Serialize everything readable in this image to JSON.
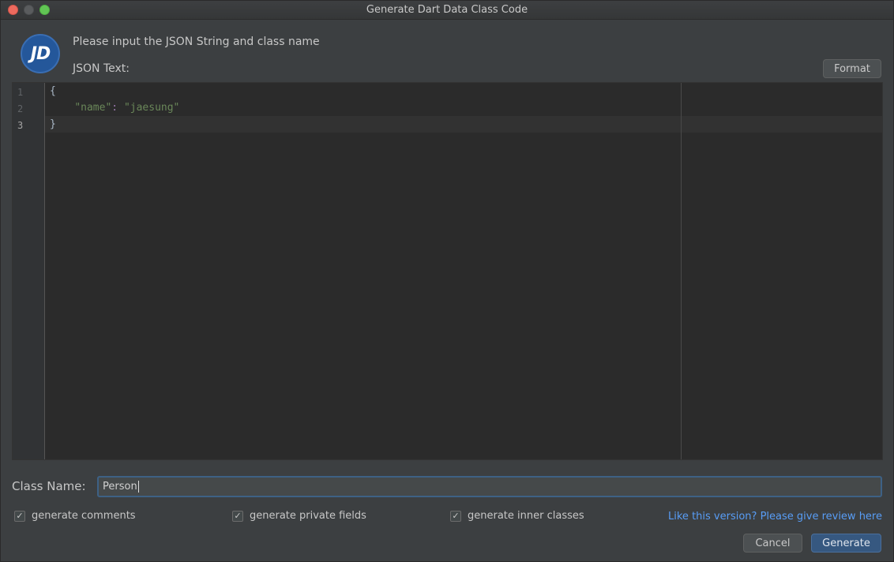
{
  "window": {
    "title": "Generate Dart Data Class Code"
  },
  "logo": {
    "text": "JD",
    "color": "#24579a"
  },
  "header": {
    "prompt": "Please input the JSON String and class name",
    "json_label": "JSON Text:",
    "format_label": "Format"
  },
  "editor": {
    "line_numbers": [
      "1",
      "2",
      "3"
    ],
    "active_line": "3",
    "lines": {
      "l1": "{",
      "l2_key": "\"name\"",
      "l2_colon": ": ",
      "l2_value": "\"jaesung\"",
      "l3": "}"
    }
  },
  "class_name": {
    "label": "Class Name:",
    "value": "Person"
  },
  "options": [
    {
      "label": "generate comments",
      "checked": true
    },
    {
      "label": "generate private fields",
      "checked": true
    },
    {
      "label": "generate inner classes",
      "checked": true
    }
  ],
  "review_link": "Like this version? Please give review here",
  "buttons": {
    "cancel": "Cancel",
    "generate": "Generate"
  },
  "colors": {
    "accent": "#365880",
    "link": "#589df6",
    "string": "#6a8759"
  }
}
